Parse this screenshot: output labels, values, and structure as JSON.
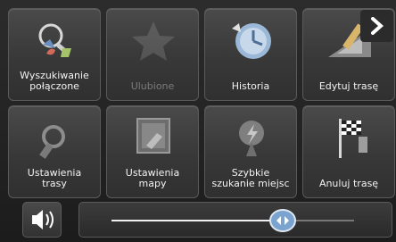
{
  "menu": {
    "tiles": [
      {
        "label": "Wyszukiwanie\npołączone",
        "enabled": true,
        "icon": "combined-search-icon"
      },
      {
        "label": "Ulubione",
        "enabled": false,
        "icon": "star-icon"
      },
      {
        "label": "Historia",
        "enabled": true,
        "icon": "history-icon"
      },
      {
        "label": "Edytuj trasę",
        "enabled": true,
        "icon": "edit-route-icon"
      },
      {
        "label": "Ustawienia\ntrasy",
        "enabled": true,
        "icon": "route-settings-icon"
      },
      {
        "label": "Ustawienia\nmapy",
        "enabled": true,
        "icon": "map-settings-icon"
      },
      {
        "label": "Szybkie\nszukanie miejsc",
        "enabled": true,
        "icon": "quick-search-icon"
      },
      {
        "label": "Anuluj trasę",
        "enabled": true,
        "icon": "cancel-route-icon"
      }
    ]
  },
  "navigation": {
    "next_icon": "chevron-right-icon"
  },
  "volume": {
    "icon": "speaker-icon",
    "level": 0.7
  },
  "colors": {
    "accent_blue": "#5f8fc4",
    "tile_bg": "#3f3f3f",
    "disabled_text": "#7b7b7b"
  }
}
